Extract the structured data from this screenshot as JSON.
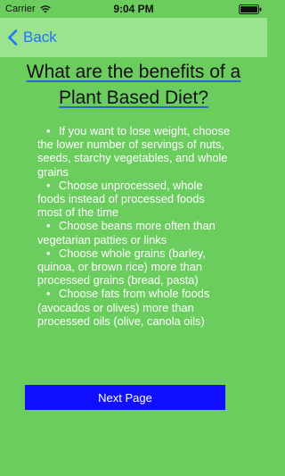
{
  "status_bar": {
    "carrier": "Carrier",
    "time": "9:04 PM"
  },
  "nav": {
    "back_label": "Back"
  },
  "content": {
    "title": "What are the benefits of a Plant Based Diet?",
    "bullet_symbol": "•",
    "bullets": [
      "If you want to lose weight, choose the lower number of servings of nuts, seeds, starchy vegetables, and whole grains",
      "Choose unprocessed, whole foods instead of processed foods most of the time",
      "Choose beans more often than vegetarian patties or links",
      "Choose whole grains (barley, quinoa, or brown rice) more than processed grains (bread, pasta)",
      "Choose fats from whole foods (avocados or olives) more than processed oils (olive, canola oils)"
    ],
    "next_button_label": "Next Page"
  },
  "colors": {
    "background": "#6ccd5f",
    "nav_background": "#9ce38f",
    "back_link": "#1e74ff",
    "title_underline": "#2f66c8",
    "next_button": "#1010ff"
  },
  "icons": {
    "wifi": "wifi-icon",
    "battery": "battery-icon",
    "back": "chevron-left-icon"
  }
}
